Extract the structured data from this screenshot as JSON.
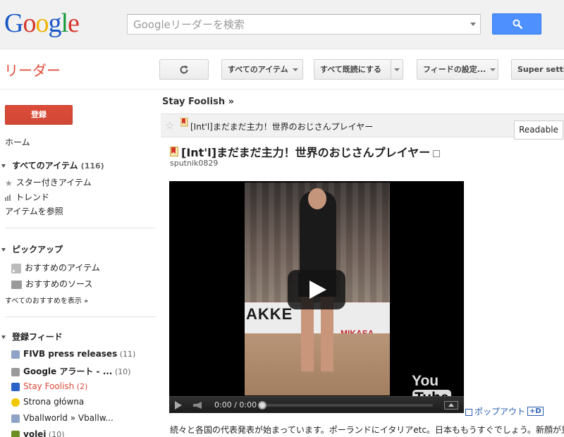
{
  "header": {
    "logo_letters": [
      {
        "ch": "G",
        "color": "#1a58c6"
      },
      {
        "ch": "o",
        "color": "#d6362a"
      },
      {
        "ch": "o",
        "color": "#f0b400"
      },
      {
        "ch": "g",
        "color": "#1a58c6"
      },
      {
        "ch": "l",
        "color": "#159a3b"
      },
      {
        "ch": "e",
        "color": "#d6362a"
      }
    ],
    "search_placeholder": "Googleリーダーを検索"
  },
  "app_title": "リーダー",
  "toolbar": {
    "all_items_label": "すべてのアイテム",
    "mark_all_read_label": "すべて既読にする",
    "feed_settings_label": "フィードの設定...",
    "super_settings_label": "Super settings"
  },
  "sidebar": {
    "subscribe_label": "登録",
    "home_label": "ホーム",
    "all_items_label": "すべてのアイテム",
    "all_items_count": "(116)",
    "starred_label": "スター付きアイテム",
    "trends_label": "トレンド",
    "browse_label": "アイテムを参照",
    "explore_heading": "ピックアップ",
    "recommended_items_label": "おすすめのアイテム",
    "recommended_sources_label": "おすすめのソース",
    "show_all_recommendations_label": "すべてのおすすめを表示 »",
    "subscriptions_heading": "登録フィード",
    "feeds": [
      {
        "label": "FIVB press releases",
        "count": "(11)",
        "icon_color": "#8ea3c6",
        "bold": true
      },
      {
        "label": "Google アラート - ...",
        "count": "(10)",
        "icon_color": "#9a9a9a",
        "bold": true
      },
      {
        "label": "Stay Foolish",
        "count": "(2)",
        "icon_color": "#2a62c8",
        "bold": false,
        "active": true
      },
      {
        "label": "Strona główna",
        "count": "",
        "icon_color": "#f0c800",
        "bold": false
      },
      {
        "label": "Vballworld » Vballw...",
        "count": "",
        "icon_color": "#8ea3c6",
        "bold": false
      },
      {
        "label": "volei",
        "count": "(10)",
        "icon_color": "#6b8e23",
        "bold": true
      }
    ]
  },
  "main": {
    "stream_title": "Stay Foolish »",
    "entry_bar_title": "[Int'l]まだまだ主力！世界のおじさんプレイヤー",
    "readable_label": "Readable",
    "entry_title": "[Int'l]まだまだ主力！世界のおじさんプレイヤー",
    "entry_author": "sputnik0829",
    "video": {
      "time": "0:00 / 0:00",
      "banner_text": "AKKE",
      "banner_text2": "MIKASA",
      "logo_you": "You",
      "logo_tube": "Tube"
    },
    "popout_label": "ポップアウト",
    "hd_label": "+D",
    "body_text": "続々と各国の代表発表が始まっています。ポーランドにイタリアetc。日本ももうすぐでしょう。新顔が見られた"
  }
}
